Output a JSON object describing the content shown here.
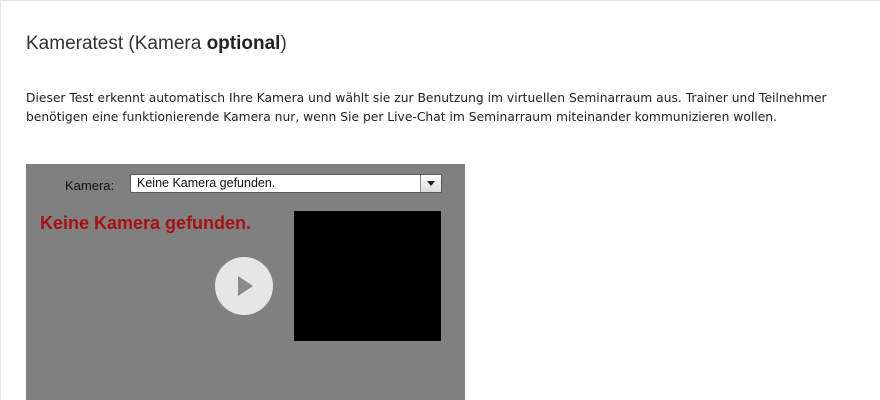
{
  "section": {
    "title_prefix": "Kameratest (Kamera ",
    "title_emphasis": "optional",
    "title_suffix": ")",
    "description": "Dieser Test erkennt automatisch Ihre Kamera und wählt sie zur Benutzung im virtuellen Seminarraum aus. Trainer und Teilnehmer benötigen eine funktionierende Kamera nur, wenn Sie per Live-Chat im Seminarraum miteinander kommunizieren wollen."
  },
  "camera_widget": {
    "label": "Kamera:",
    "select_value": "Keine Kamera gefunden.",
    "error_message": "Keine Kamera gefunden.",
    "play_icon": "play-icon",
    "dropdown_icon": "chevron-down-icon"
  },
  "colors": {
    "widget_background": "#808080",
    "error_text": "#a80f12",
    "preview_background": "#000000"
  }
}
